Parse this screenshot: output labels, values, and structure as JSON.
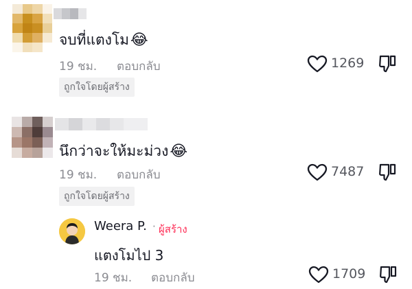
{
  "comments": [
    {
      "text": "จบที่แตงโม",
      "emoji": "😂",
      "time": "19 ชม.",
      "reply_label": "ตอบกลับ",
      "badge": "ถูกใจโดยผู้สร้าง",
      "likes": "1269"
    },
    {
      "text": "นึกว่าจะให้มะม่วง",
      "emoji": "😂",
      "time": "19 ชม.",
      "reply_label": "ตอบกลับ",
      "badge": "ถูกใจโดยผู้สร้าง",
      "likes": "7487"
    }
  ],
  "reply": {
    "author": "Weera P.",
    "separator": "·",
    "creator_label": "ผู้สร้าง",
    "text": "แตงโมไป 3",
    "time": "19 ชม.",
    "reply_label": "ตอบกลับ",
    "likes": "1709"
  },
  "colors": {
    "text": "#161823",
    "secondary": "#8a8b91",
    "creator": "#fe2c55",
    "badge_bg": "#f1f1f2"
  },
  "icons": [
    "heart-icon",
    "dislike-icon"
  ]
}
